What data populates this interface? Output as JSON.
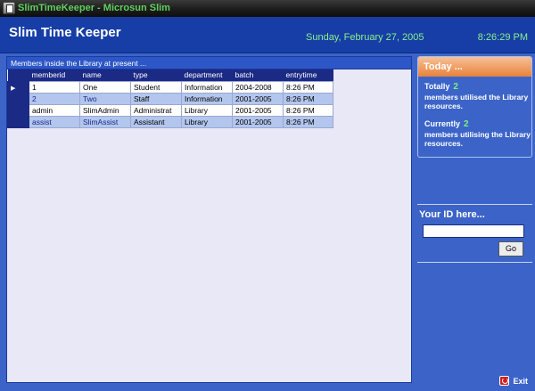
{
  "window": {
    "title": "SlimTimeKeeper - Microsun Slim"
  },
  "header": {
    "app_name": "Slim Time Keeper",
    "date": "Sunday, February 27, 2005",
    "time": "8:26:29 PM"
  },
  "members_panel": {
    "heading": "Members inside the Library at present ...",
    "columns": [
      "memberid",
      "name",
      "type",
      "department",
      "batch",
      "entrytime"
    ],
    "rows": [
      [
        "1",
        "One",
        "Student",
        "Information",
        "2004-2008",
        "8:26 PM"
      ],
      [
        "2",
        "Two",
        "Staff",
        "Information",
        "2001-2005",
        "8:26 PM"
      ],
      [
        "admin",
        "SlimAdmin",
        "Administrat",
        "Library",
        "2001-2005",
        "8:26 PM"
      ],
      [
        "assist",
        "SlimAssist",
        "Assistant",
        "Library",
        "2001-2005",
        "8:26 PM"
      ]
    ],
    "selected_row_marker": "▶"
  },
  "today": {
    "heading": "Today ...",
    "totally_label": "Totally",
    "totally_count": "2",
    "totally_desc": "members utilised the Library resources.",
    "currently_label": "Currently",
    "currently_count": "2",
    "currently_desc": "members utilising the Library resources."
  },
  "id_entry": {
    "label": "Your ID here...",
    "value": "",
    "go_label": "Go"
  },
  "footer": {
    "exit_label": "Exit"
  },
  "colors": {
    "background": "#3c64c8",
    "header": "#163ea6",
    "accent_green": "#7cf07c",
    "today_orange": "#e8823c"
  }
}
